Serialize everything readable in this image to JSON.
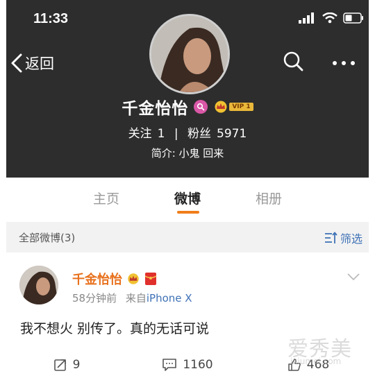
{
  "status_bar": {
    "time": "11:33",
    "icons": [
      "signal-icon",
      "wifi-icon",
      "battery-icon"
    ]
  },
  "nav": {
    "back_label": "返回",
    "icons": [
      "chevron-left-icon",
      "search-icon",
      "more-icon"
    ]
  },
  "profile": {
    "name": "千金怡怡",
    "vip_label": "VIP 1",
    "following_label": "关注",
    "following_count": "1",
    "divider": "|",
    "followers_label": "粉丝",
    "followers_count": "5971",
    "bio": "简介: 小鬼 回来"
  },
  "tabs": [
    {
      "label": "主页",
      "active": false
    },
    {
      "label": "微博",
      "active": true
    },
    {
      "label": "相册",
      "active": false
    }
  ],
  "filter": {
    "title": "全部微博(3)",
    "button_label": "筛选"
  },
  "post": {
    "author": "千金怡怡",
    "time": "58分钟前",
    "source_prefix": "来自",
    "source_device": "iPhone X",
    "text": "我不想火 别传了。真的无话可说",
    "actions": {
      "repost_count": "9",
      "comment_count": "1160",
      "like_count": "468"
    }
  },
  "watermark": {
    "main": "爱秀美",
    "sub": "ixiumei.com"
  },
  "colors": {
    "header_bg": "#2d2d2d",
    "accent_orange": "#f07e1b",
    "link_blue": "#3f72b6",
    "name_orange": "#e8701c"
  }
}
